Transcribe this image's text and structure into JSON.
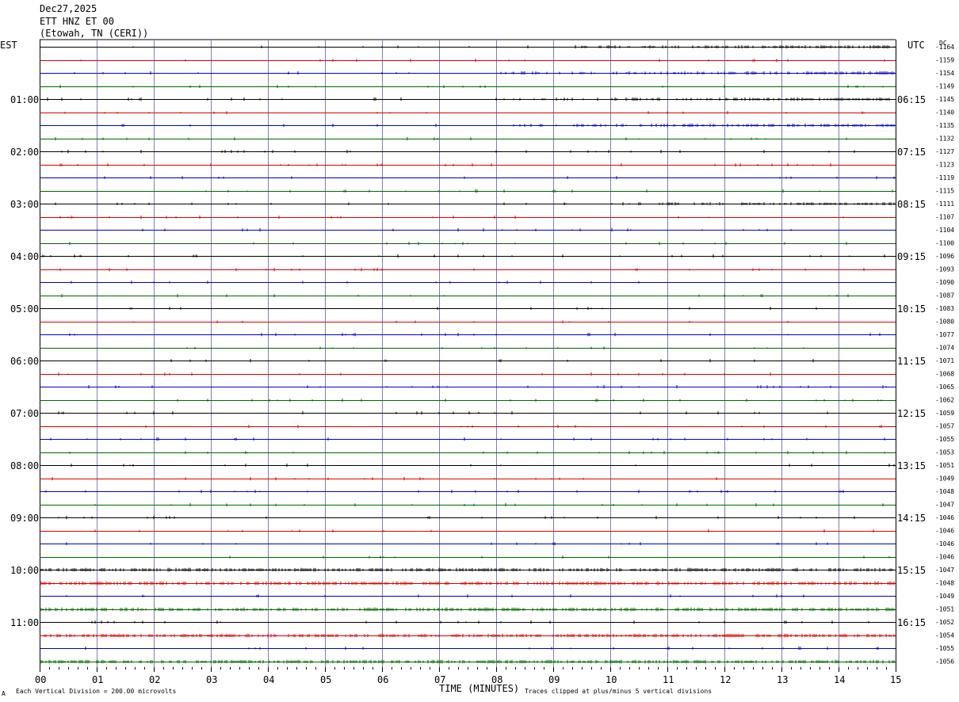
{
  "header": {
    "date": "Dec27,2025",
    "station": "ETT HNZ ET 00",
    "location": "(Etowah, TN (CERI))"
  },
  "labels": {
    "left_tz": "EST",
    "right_tz": "UTC",
    "dc_header": "DC"
  },
  "footer": {
    "scale_note": "Each Vertical Division =  200.00 microvolts",
    "clip_note": "Traces clipped at plus/minus 5 vertical divisions",
    "mark": "A"
  },
  "chart_data": {
    "type": "line",
    "title": "",
    "xlabel": "TIME (MINUTES)",
    "ylabel": "",
    "xlim": [
      0,
      15
    ],
    "x_ticks": [
      "00",
      "01",
      "02",
      "03",
      "04",
      "05",
      "06",
      "07",
      "08",
      "09",
      "10",
      "11",
      "12",
      "13",
      "14",
      "15"
    ],
    "grid": true,
    "trace_colors": [
      "#000000",
      "#dd0000",
      "#0000cc",
      "#006600"
    ],
    "left_time_labels": [
      "01:00",
      "02:00",
      "03:00",
      "04:00",
      "05:00",
      "06:00",
      "07:00",
      "08:00",
      "09:00",
      "10:00",
      "11:00"
    ],
    "right_time_labels": [
      "06:15",
      "07:15",
      "08:15",
      "09:15",
      "10:15",
      "11:15",
      "12:15",
      "13:15",
      "14:15",
      "15:15",
      "16:15"
    ],
    "dc_offsets": [
      "-1164",
      "-1159",
      "-1154",
      "-1149",
      "-1145",
      "-1140",
      "-1135",
      "-1132",
      "-1127",
      "-1123",
      "-1119",
      "-1115",
      "-1111",
      "-1107",
      "-1104",
      "-1100",
      "-1096",
      "-1093",
      "-1090",
      "-1087",
      "-1083",
      "-1080",
      "-1077",
      "-1074",
      "-1071",
      "-1068",
      "-1065",
      "-1062",
      "-1059",
      "-1057",
      "-1055",
      "-1053",
      "-1051",
      "-1049",
      "-1048",
      "-1047",
      "-1046",
      "-1046",
      "-1046",
      "-1046",
      "-1047",
      "-1048",
      "-1049",
      "-1051",
      "-1052",
      "-1054",
      "-1055",
      "-1056"
    ]
  }
}
